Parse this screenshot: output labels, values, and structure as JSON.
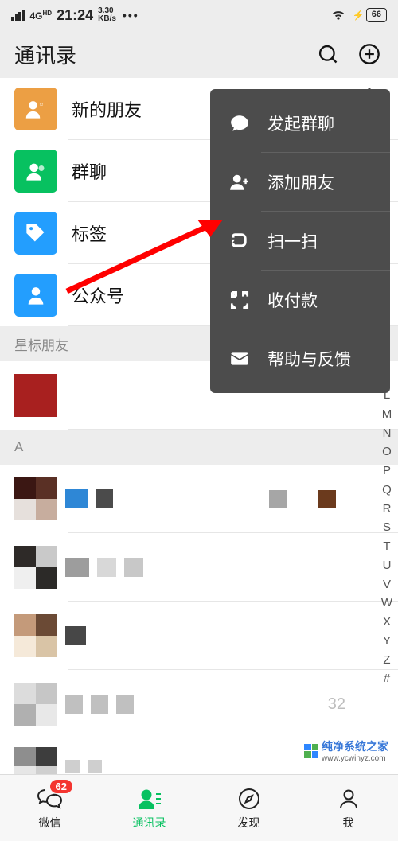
{
  "status": {
    "network": "4G",
    "network_sup": "HD",
    "time": "21:24",
    "rate_top": "3.30",
    "rate_bot": "KB/s",
    "battery": "66"
  },
  "header": {
    "title": "通讯录"
  },
  "shortcuts": [
    {
      "label": "新的朋友",
      "color": "#ec9f44",
      "icon": "new-friends-icon"
    },
    {
      "label": "群聊",
      "color": "#07c160",
      "icon": "group-chat-icon"
    },
    {
      "label": "标签",
      "color": "#239efe",
      "icon": "tag-icon"
    },
    {
      "label": "公众号",
      "color": "#239efe",
      "icon": "official-account-icon"
    }
  ],
  "sections": {
    "starred": "星标朋友",
    "A": "A"
  },
  "popover": {
    "items": [
      {
        "label": "发起群聊",
        "icon": "chat-bubble-icon"
      },
      {
        "label": "添加朋友",
        "icon": "add-friend-icon"
      },
      {
        "label": "扫一扫",
        "icon": "scan-icon"
      },
      {
        "label": "收付款",
        "icon": "pay-icon"
      },
      {
        "label": "帮助与反馈",
        "icon": "mail-icon"
      }
    ]
  },
  "index_letters": [
    "L",
    "M",
    "N",
    "O",
    "P",
    "Q",
    "R",
    "S",
    "T",
    "U",
    "V",
    "W",
    "X",
    "Y",
    "Z",
    "#"
  ],
  "tabbar": {
    "items": [
      {
        "label": "微信",
        "icon": "chat-icon",
        "badge": "62"
      },
      {
        "label": "通讯录",
        "icon": "contacts-icon",
        "active": true
      },
      {
        "label": "发现",
        "icon": "discover-icon"
      },
      {
        "label": "我",
        "icon": "me-icon"
      }
    ]
  },
  "misc": {
    "partial_number": "32"
  },
  "watermark": {
    "text": "纯净系统之家",
    "url": "www.ycwinyz.com"
  }
}
